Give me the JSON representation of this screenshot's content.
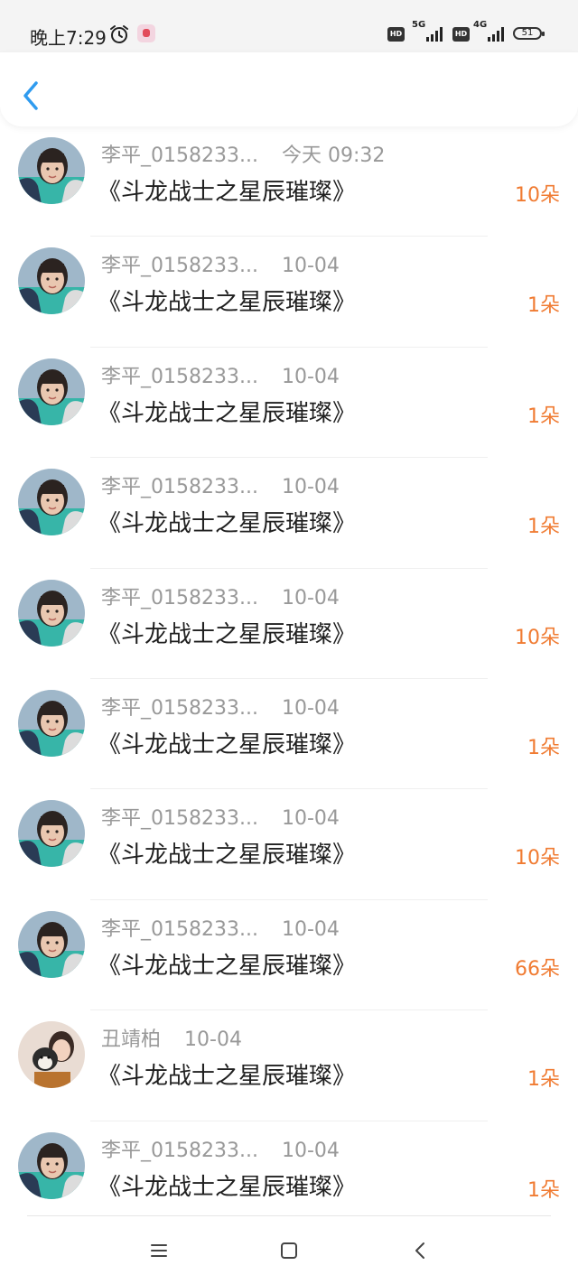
{
  "status_bar": {
    "time": "晚上7:29",
    "icons": [
      "alarm-icon",
      "app-notification-icon"
    ],
    "sim1": {
      "hd": "HD",
      "network": "5G"
    },
    "sim2": {
      "hd": "HD",
      "network": "4G"
    },
    "battery": "51"
  },
  "header": {
    "back_icon": "chevron-left-icon"
  },
  "accent_color": "#f07b32",
  "back_color": "#2f9bef",
  "gifts": [
    {
      "sender": "李平_0158233...",
      "date": "今天 09:32",
      "book": "《斗龙战士之星辰璀璨》",
      "count": "10朵",
      "avatar": "girl-photo"
    },
    {
      "sender": "李平_0158233...",
      "date": "10-04",
      "book": "《斗龙战士之星辰璀璨》",
      "count": "1朵",
      "avatar": "girl-photo"
    },
    {
      "sender": "李平_0158233...",
      "date": "10-04",
      "book": "《斗龙战士之星辰璀璨》",
      "count": "1朵",
      "avatar": "girl-photo"
    },
    {
      "sender": "李平_0158233...",
      "date": "10-04",
      "book": "《斗龙战士之星辰璀璨》",
      "count": "1朵",
      "avatar": "girl-photo"
    },
    {
      "sender": "李平_0158233...",
      "date": "10-04",
      "book": "《斗龙战士之星辰璀璨》",
      "count": "10朵",
      "avatar": "girl-photo"
    },
    {
      "sender": "李平_0158233...",
      "date": "10-04",
      "book": "《斗龙战士之星辰璀璨》",
      "count": "1朵",
      "avatar": "girl-photo"
    },
    {
      "sender": "李平_0158233...",
      "date": "10-04",
      "book": "《斗龙战士之星辰璀璨》",
      "count": "10朵",
      "avatar": "girl-photo"
    },
    {
      "sender": "李平_0158233...",
      "date": "10-04",
      "book": "《斗龙战士之星辰璀璨》",
      "count": "66朵",
      "avatar": "girl-photo"
    },
    {
      "sender": "丑靖柏",
      "date": "10-04",
      "book": "《斗龙战士之星辰璀璨》",
      "count": "1朵",
      "avatar": "woman-with-dog-photo"
    },
    {
      "sender": "李平_0158233...",
      "date": "10-04",
      "book": "《斗龙战士之星辰璀璨》",
      "count": "1朵",
      "avatar": "girl-photo"
    }
  ],
  "nav_bar": {
    "buttons": [
      "menu-icon",
      "home-icon",
      "back-icon"
    ]
  }
}
